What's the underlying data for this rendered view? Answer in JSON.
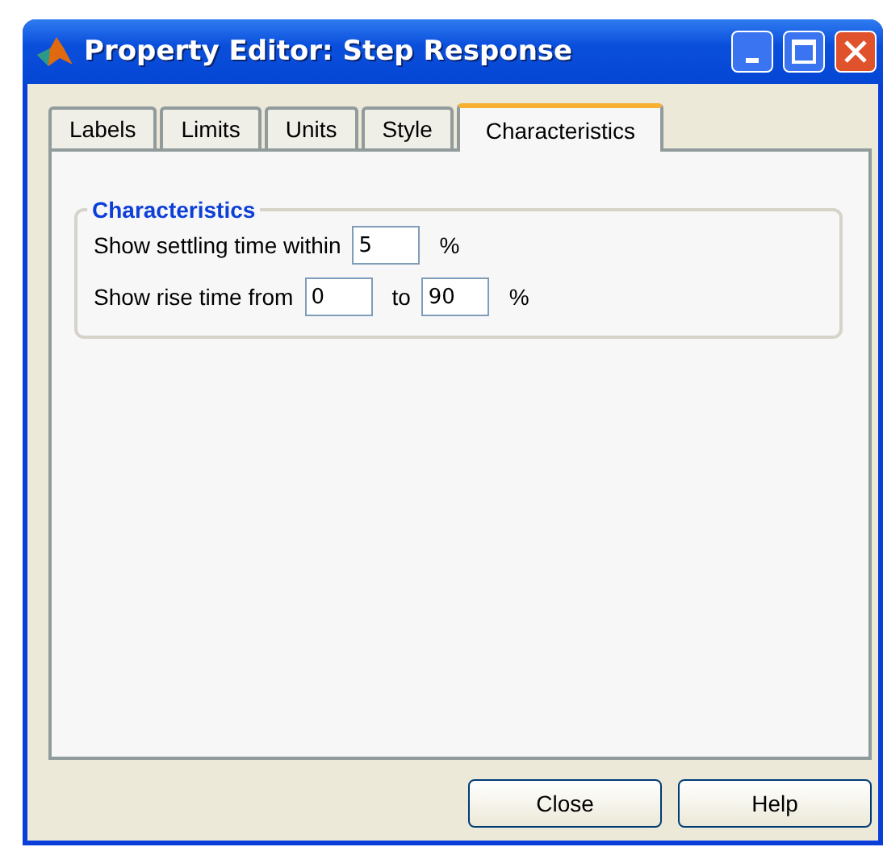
{
  "window": {
    "title": "Property Editor: Step Response"
  },
  "tabs": [
    {
      "label": "Labels",
      "selected": false
    },
    {
      "label": "Limits",
      "selected": false
    },
    {
      "label": "Units",
      "selected": false
    },
    {
      "label": "Style",
      "selected": false
    },
    {
      "label": "Characteristics",
      "selected": true
    }
  ],
  "group": {
    "title": "Characteristics",
    "rows": [
      {
        "parts": [
          {
            "kind": "text",
            "text": "Show settling time within"
          },
          {
            "kind": "field",
            "value": "5"
          },
          {
            "kind": "text",
            "text": "%"
          }
        ]
      },
      {
        "parts": [
          {
            "kind": "text",
            "text": "Show rise time from"
          },
          {
            "kind": "field",
            "value": "0"
          },
          {
            "kind": "text",
            "text": "to"
          },
          {
            "kind": "field",
            "value": "90"
          },
          {
            "kind": "text",
            "text": "%"
          }
        ]
      }
    ]
  },
  "buttons": [
    "Close",
    "Help"
  ]
}
